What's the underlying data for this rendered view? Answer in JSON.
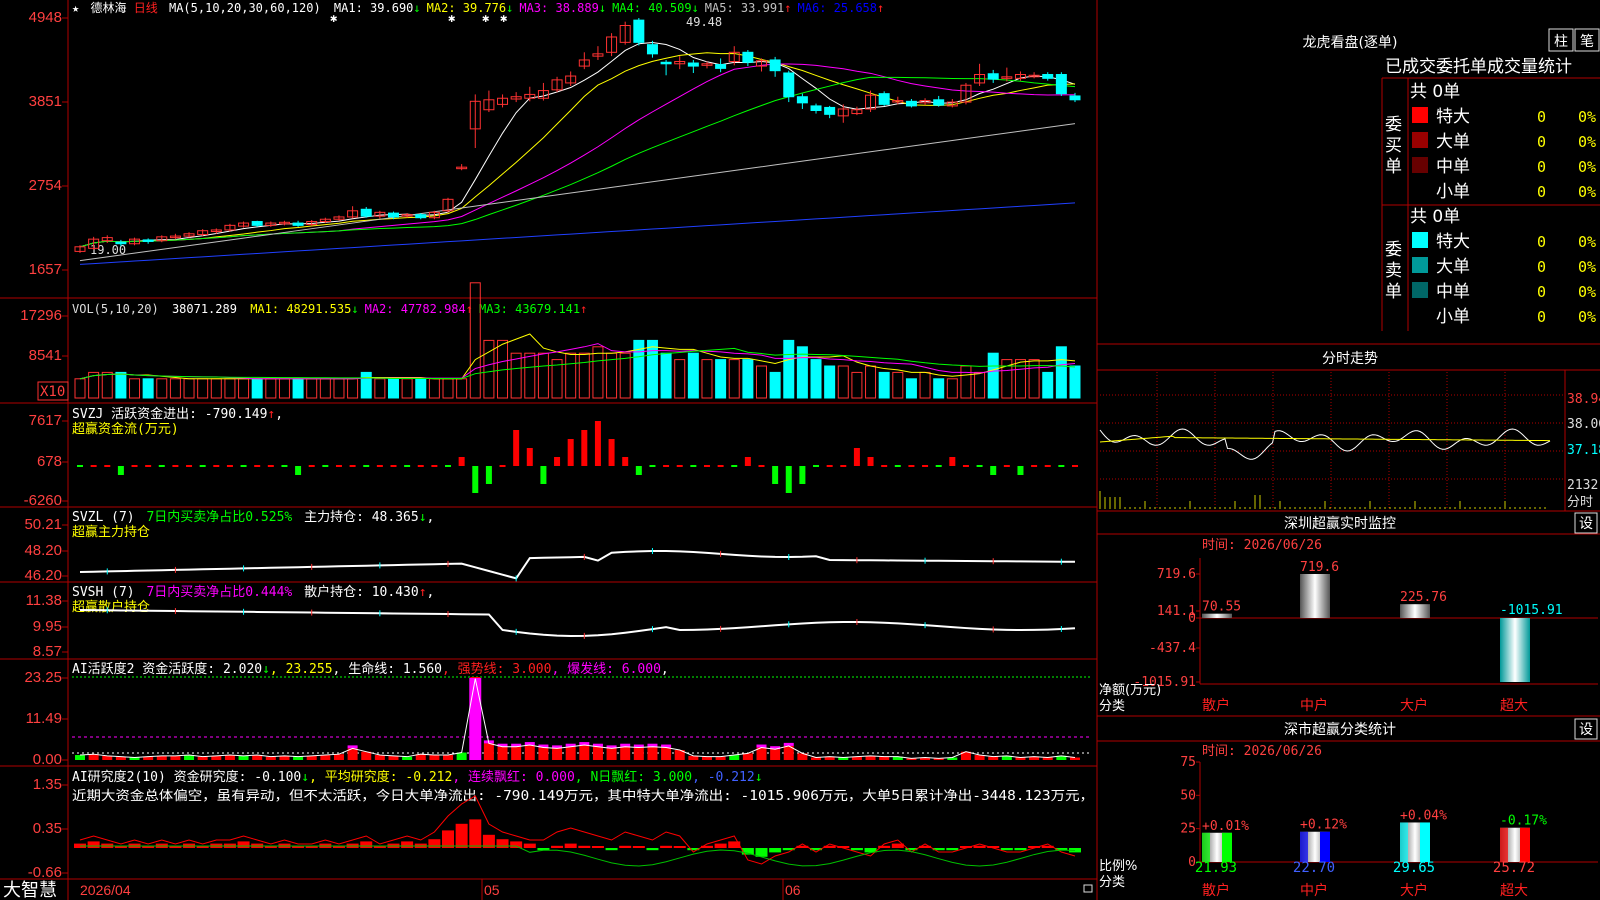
{
  "stock": {
    "star": "★",
    "name": "德林海",
    "period": "日线",
    "ma_header": "MA(5,10,20,30,60,120)",
    "ma_items": [
      {
        "label": "MA1: 39.690",
        "arrow": "↓",
        "color": "#ffffff"
      },
      {
        "label": "MA2: 39.776",
        "arrow": "↓",
        "color": "#ffff00"
      },
      {
        "label": "MA3: 38.889",
        "arrow": "↓",
        "color": "#ff00ff"
      },
      {
        "label": "MA4: 40.509",
        "arrow": "↓",
        "color": "#00ff00"
      },
      {
        "label": "MA5: 33.991",
        "arrow": "↑",
        "color": "#c0c0c0"
      },
      {
        "label": "MA6: 25.658",
        "arrow": "↑",
        "color": "#0000ff"
      }
    ],
    "high_label": "49.48",
    "low_label": "19.00"
  },
  "price_axis": [
    "4948",
    "3851",
    "2754",
    "1657"
  ],
  "vol_panel": {
    "header": "VOL(5,10,20)",
    "value": "38071.289",
    "items": [
      {
        "label": "MA1: 48291.535",
        "arrow": "↓",
        "color": "#ffff00"
      },
      {
        "label": "MA2: 47782.984",
        "arrow": "↑",
        "color": "#ff00ff"
      },
      {
        "label": "MA3: 43679.141",
        "arrow": "↑",
        "color": "#00ff00"
      }
    ],
    "axis": [
      "17296",
      "8541"
    ],
    "unit": "X10"
  },
  "svzj_panel": {
    "line1": "SVZJ  活跃资金进出: -790.149",
    "arrow": "↑",
    "tail": ",",
    "line2": "超赢资金流(万元)",
    "axis": [
      "7617",
      "678",
      "-6260"
    ]
  },
  "svzl_panel": {
    "header": "SVZL  (7)",
    "ratio": "7日内买卖净占比0.525%",
    "hold": "主力持仓: 48.365",
    "arrow": "↓",
    "tail": ",",
    "line2": "超赢主力持仓",
    "axis": [
      "50.21",
      "48.20",
      "46.20"
    ]
  },
  "svsh_panel": {
    "header": "SVSH  (7)",
    "ratio": "7日内买卖净占比0.444%",
    "hold": "散户持仓: 10.430",
    "arrow": "↑",
    "tail": ",",
    "line2": "超赢散户持仓",
    "axis": [
      "11.38",
      "9.95",
      "8.57"
    ]
  },
  "ai_active": {
    "header": "AI活跃度2 资金活跃度: 2.020",
    "a1": "↓",
    "v2": ", 23.255",
    "v3": ", 生命线: 1.560",
    "v4": ", 强势线: 3.000",
    "v5": ", 爆发线: 6.000",
    "tail": ",",
    "axis": [
      "23.25",
      "11.49",
      "0.00"
    ]
  },
  "ai_research": {
    "header": "AI研究度2(10) 资金研究度: -0.100",
    "a1": "↓",
    "v2": ", 平均研究度: -0.212",
    "v3": ", 连续飘红: 0.000",
    "v4": ", N日飘红: 3.000",
    "v5": ", -0.212",
    "a5": "↓",
    "comment": "近期大资金总体偏空，虽有异动，但不太活跃，今日大单净流出: -790.149万元，其中特大单净流出: -1015.906万元，大单5日累计净出-3448.123万元，",
    "axis": [
      "1.35",
      "0.35",
      "-0.66"
    ]
  },
  "footer": {
    "brand": "大智慧",
    "date0": "2026/04",
    "m05": "05",
    "m06": "06"
  },
  "longhu": {
    "title": "龙虎看盘(逐单)",
    "btn1": "柱",
    "btn2": "笔",
    "subtitle": "已成交委托单成交量统计",
    "buy_label": "委买单",
    "sell_label": "委卖单",
    "buy_total": "共 0单",
    "sell_total": "共 0单",
    "buy_rows": [
      {
        "name": "特大",
        "count": "0",
        "pct": "0%",
        "color": "#ff0000"
      },
      {
        "name": "大单",
        "count": "0",
        "pct": "0%",
        "color": "#990000"
      },
      {
        "name": "中单",
        "count": "0",
        "pct": "0%",
        "color": "#660000"
      },
      {
        "name": "小单",
        "count": "0",
        "pct": "0%",
        "color": "#000000"
      }
    ],
    "sell_rows": [
      {
        "name": "特大",
        "count": "0",
        "pct": "0%",
        "color": "#00ffff"
      },
      {
        "name": "大单",
        "count": "0",
        "pct": "0%",
        "color": "#009999"
      },
      {
        "name": "中单",
        "count": "0",
        "pct": "0%",
        "color": "#006666"
      },
      {
        "name": "小单",
        "count": "0",
        "pct": "0%",
        "color": "#000000"
      }
    ]
  },
  "fenshi": {
    "title": "分时走势",
    "axis": [
      "38.94",
      "38.06",
      "37.18"
    ],
    "vol_max": "2132",
    "vol_unit": "分时"
  },
  "monitor": {
    "title": "深圳超赢实时监控",
    "set": "设",
    "time": "时间: 2026/06/26",
    "axis": [
      "719.6",
      "141.1",
      "0",
      "-437.4",
      "-1015.91"
    ],
    "y_label": "净额(万元)",
    "x_label": "分类",
    "bars": [
      {
        "cat": "散户",
        "value": 70.55,
        "label": "70.55"
      },
      {
        "cat": "中户",
        "value": 719.6,
        "label": "719.6"
      },
      {
        "cat": "大户",
        "value": 225.76,
        "label": "225.76"
      },
      {
        "cat": "超大",
        "value": -1015.91,
        "label": "-1015.91"
      }
    ]
  },
  "classify": {
    "title": "深市超赢分类统计",
    "set": "设",
    "time": "时间: 2026/06/26",
    "axis": [
      "75",
      "50",
      "25",
      "0"
    ],
    "y_label": "比例%",
    "x_label": "分类",
    "bars": [
      {
        "cat": "散户",
        "value": 21.93,
        "label": "21.93",
        "change": "+0.01%",
        "color": "#00ff00"
      },
      {
        "cat": "中户",
        "value": 22.7,
        "label": "22.70",
        "change": "+0.12%",
        "color": "#0000ff"
      },
      {
        "cat": "大户",
        "value": 29.65,
        "label": "29.65",
        "change": "+0.04%",
        "color": "#00ffff"
      },
      {
        "cat": "超大",
        "value": 25.72,
        "label": "25.72",
        "change": "-0.17%",
        "color": "#ff0000"
      }
    ]
  },
  "colors": {
    "up": "#ff3232",
    "down": "#00ffff",
    "grid": "#b00000",
    "axis_text": "#ff4040"
  }
}
